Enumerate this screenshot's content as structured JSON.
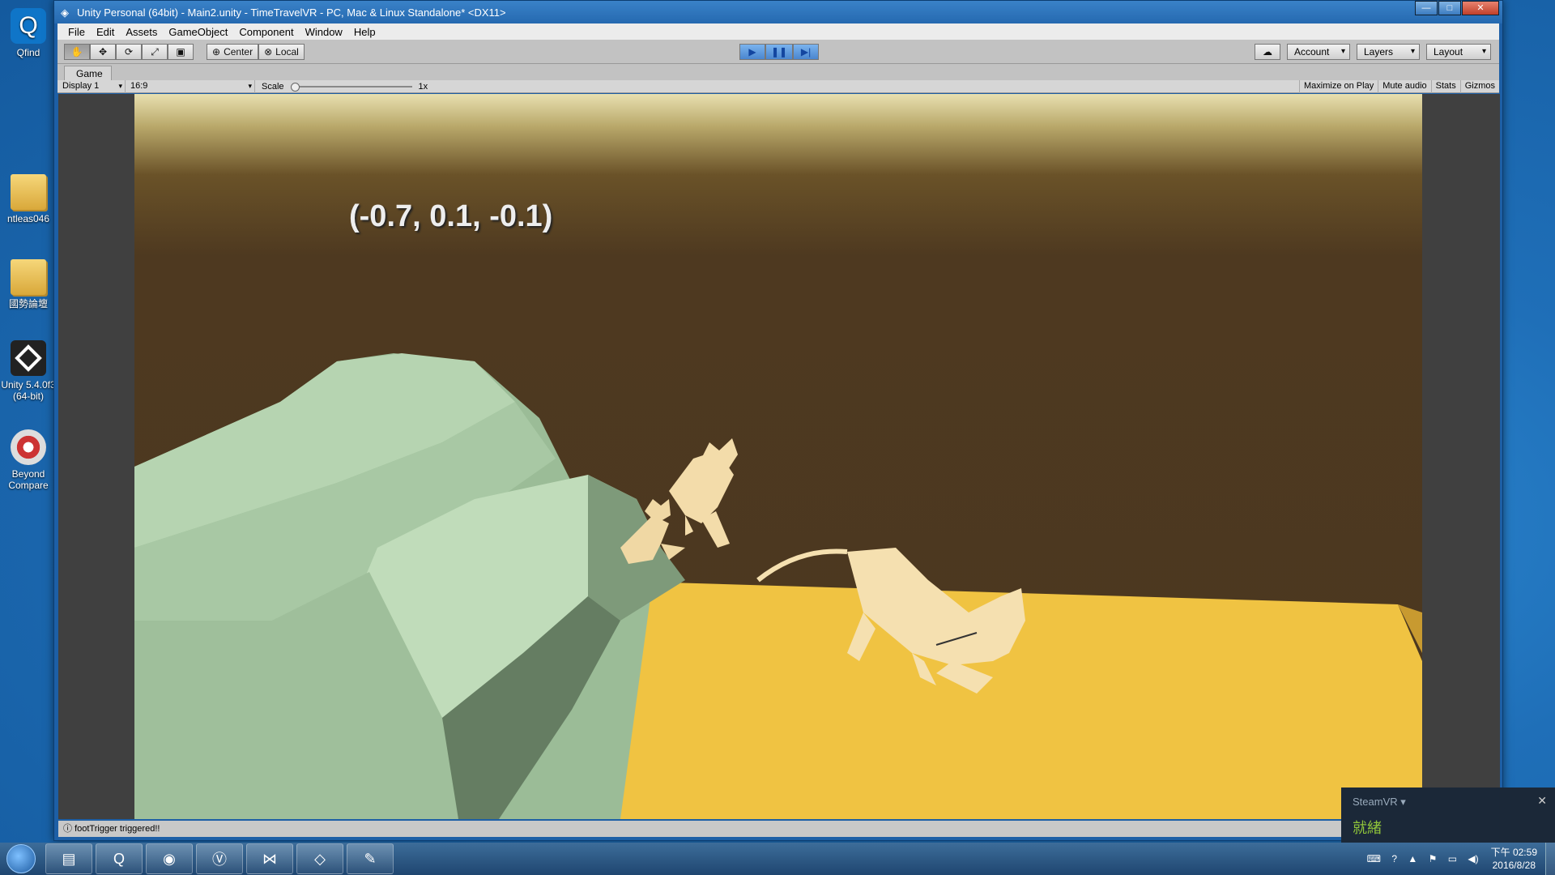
{
  "desktop": {
    "icons": [
      {
        "label": "Qfind",
        "icon": "search-app-icon"
      },
      {
        "label": "ntleas046",
        "icon": "folder-icon"
      },
      {
        "label": "國勢論壇",
        "icon": "folder-icon"
      },
      {
        "label": "Unity 5.4.0f3 (64-bit)",
        "icon": "unity-icon"
      },
      {
        "label": "Beyond Compare",
        "icon": "beyond-compare-icon"
      }
    ]
  },
  "window": {
    "title": "Unity Personal (64bit) - Main2.unity - TimeTravelVR - PC, Mac & Linux Standalone* <DX11>",
    "controls": {
      "minimize": "—",
      "maximize": "□",
      "close": "✕"
    }
  },
  "menu": [
    "File",
    "Edit",
    "Assets",
    "GameObject",
    "Component",
    "Window",
    "Help"
  ],
  "toolbar": {
    "tools": [
      "hand-tool-icon",
      "move-tool-icon",
      "rotate-tool-icon",
      "scale-tool-icon",
      "rect-tool-icon"
    ],
    "pivot_mode": "Center",
    "pivot_rotation": "Local",
    "play": "▶",
    "pause": "❚❚",
    "step": "▶|",
    "cloud": "☁",
    "account": "Account",
    "layers": "Layers",
    "layout": "Layout"
  },
  "game_view": {
    "tab": "Game",
    "display": "Display 1",
    "aspect": "16:9",
    "scale_label": "Scale",
    "scale_value": "1x",
    "maximize_on_play": "Maximize on Play",
    "mute_audio": "Mute audio",
    "stats": "Stats",
    "gizmos": "Gizmos",
    "coords_text": "(-0.7, 0.1, -0.1)"
  },
  "status": {
    "message": "footTrigger triggered!!"
  },
  "steamvr": {
    "title": "SteamVR ▾",
    "status": "就緒",
    "close": "✕"
  },
  "taskbar": {
    "apps": [
      "explorer-icon",
      "qfind-icon",
      "chrome-icon",
      "vr-icon",
      "visual-studio-icon",
      "unity-icon",
      "paint-icon"
    ],
    "time": "下午 02:59",
    "date": "2016/8/28"
  },
  "colors": {
    "floor": "#f0c342",
    "wall": "#4b381f",
    "sofa": "#a8c8a4",
    "cat": "#f5e0b0",
    "play_active": "#4a86cf"
  }
}
